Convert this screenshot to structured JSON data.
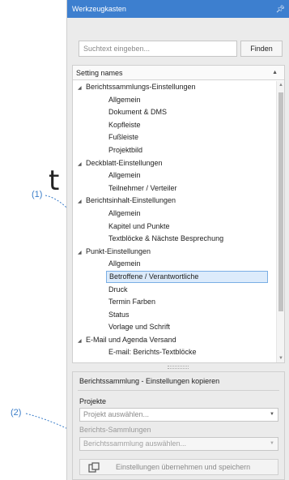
{
  "fragment_text": "t",
  "callouts": {
    "one": "(1)",
    "two": "(2)"
  },
  "panel": {
    "title": "Werkzeugkasten",
    "pin_icon": "pin-icon",
    "search": {
      "placeholder": "Suchtext eingeben...",
      "value": ""
    },
    "find_label": "Finden",
    "tree": {
      "header": "Setting names",
      "nodes": [
        {
          "label": "Berichtssammlungs-Einstellungen",
          "level": 0
        },
        {
          "label": "Allgemein",
          "level": 1
        },
        {
          "label": "Dokument & DMS",
          "level": 1
        },
        {
          "label": "Kopfleiste",
          "level": 1
        },
        {
          "label": "Fußleiste",
          "level": 1
        },
        {
          "label": "Projektbild",
          "level": 1
        },
        {
          "label": "Deckblatt-Einstellungen",
          "level": 0
        },
        {
          "label": "Allgemein",
          "level": 1
        },
        {
          "label": "Teilnehmer / Verteiler",
          "level": 1
        },
        {
          "label": "Berichtsinhalt-Einstellungen",
          "level": 0
        },
        {
          "label": "Allgemein",
          "level": 1
        },
        {
          "label": "Kapitel und Punkte",
          "level": 1
        },
        {
          "label": "Textblöcke & Nächste Besprechung",
          "level": 1
        },
        {
          "label": "Punkt-Einstellungen",
          "level": 0
        },
        {
          "label": "Allgemein",
          "level": 1
        },
        {
          "label": "Betroffene / Verantwortliche",
          "level": 1,
          "selected": true
        },
        {
          "label": "Druck",
          "level": 1
        },
        {
          "label": "Termin Farben",
          "level": 1
        },
        {
          "label": "Status",
          "level": 1
        },
        {
          "label": "Vorlage und Schrift",
          "level": 1
        },
        {
          "label": "E-Mail und Agenda Versand",
          "level": 0
        },
        {
          "label": "E-mail: Berichts-Textblöcke",
          "level": 1
        }
      ]
    },
    "copy_group": {
      "title": "Berichtssammlung - Einstellungen kopieren",
      "projects_label": "Projekte",
      "projects_placeholder": "Projekt auswählen...",
      "collections_label": "Berichts-Sammlungen",
      "collections_placeholder": "Berichtssammlung auswählen...",
      "apply_label": "Einstellungen übernehmen und speichern"
    }
  },
  "colors": {
    "titlebar": "#3d7fcf",
    "callout": "#3a7dc9",
    "selection_fill": "#dcebfb",
    "selection_border": "#7aaee5"
  }
}
